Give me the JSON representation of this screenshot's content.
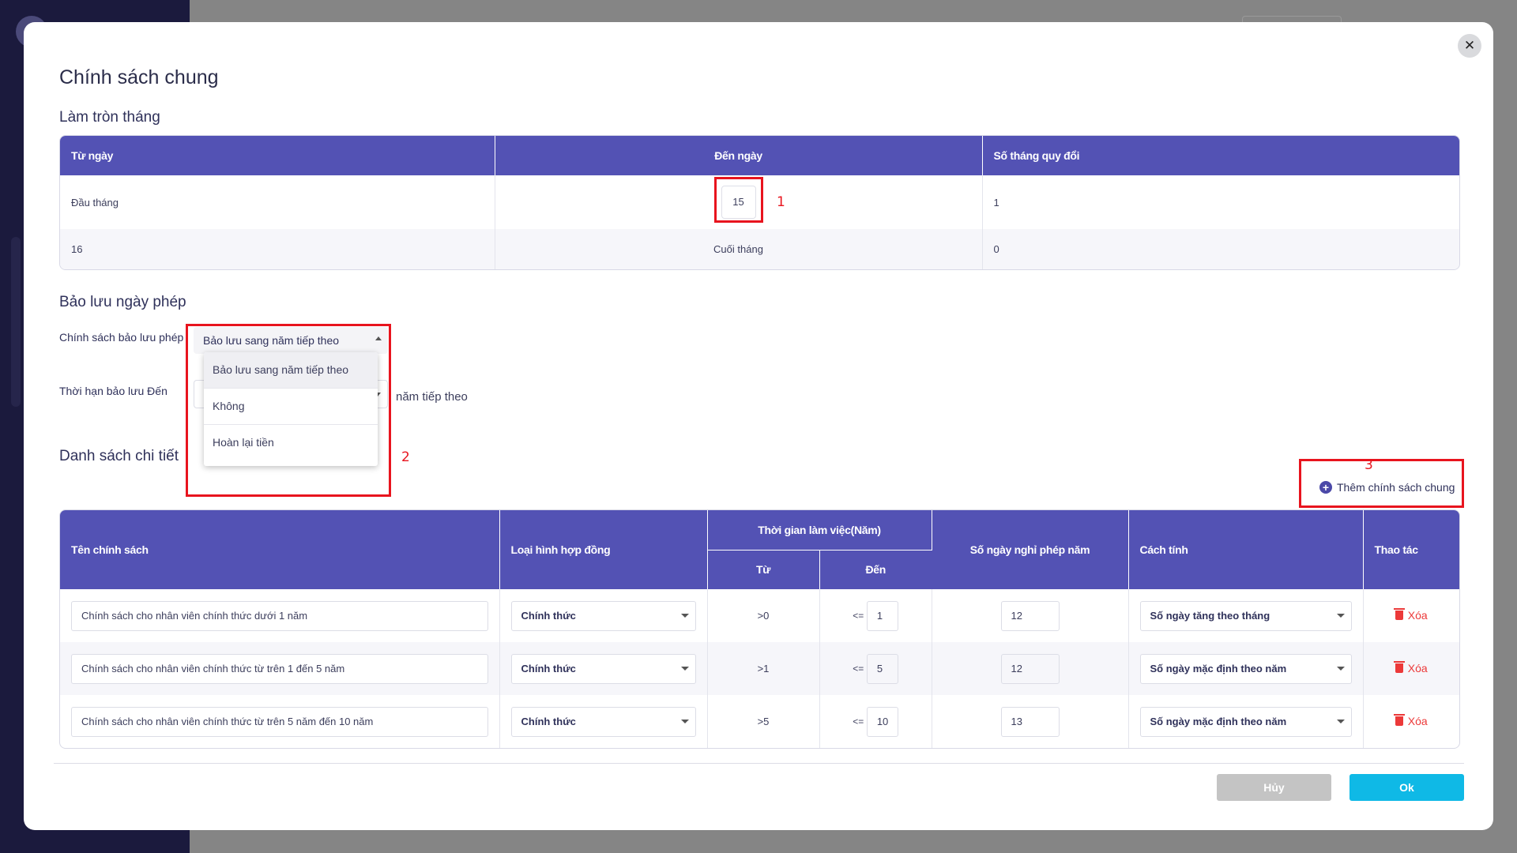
{
  "modal": {
    "title": "Chính sách chung",
    "close_glyph": "✕"
  },
  "rounding": {
    "title": "Làm tròn tháng",
    "headers": [
      "Từ ngày",
      "Đến ngày",
      "Số tháng quy đổi"
    ],
    "rows": [
      {
        "from": "Đầu tháng",
        "to": "15",
        "months": "1"
      },
      {
        "from": "16",
        "to": "Cuối tháng",
        "months": "0"
      }
    ]
  },
  "carryover": {
    "title": "Bảo lưu ngày phép",
    "policy_label": "Chính sách bảo lưu phép",
    "policy_value": "Bảo lưu sang năm tiếp theo",
    "deadline_label": "Thời hạn bảo lưu Đến",
    "deadline_suffix": "năm tiếp theo",
    "options": [
      "Bảo lưu sang năm tiếp theo",
      "Không",
      "Hoàn lại tiền"
    ]
  },
  "details": {
    "title": "Danh sách chi tiết",
    "add_label": "Thêm chính sách chung",
    "headers": {
      "name": "Tên chính sách",
      "contract": "Loại hình hợp đồng",
      "work_time": "Thời gian làm việc(Năm)",
      "from": "Từ",
      "to": "Đến",
      "days": "Số ngày nghỉ phép năm",
      "method": "Cách tính",
      "action": "Thao tác"
    },
    "rows": [
      {
        "name": "Chính sách cho nhân viên chính thức dưới 1 năm",
        "contract": "Chính thức",
        "from": ">0",
        "op": "<=",
        "to": "1",
        "days": "12",
        "method": "Số ngày tăng theo tháng",
        "delete": "Xóa"
      },
      {
        "name": "Chính sách cho nhân viên chính thức từ trên 1 đến 5 năm",
        "contract": "Chính thức",
        "from": ">1",
        "op": "<=",
        "to": "5",
        "days": "12",
        "method": "Số ngày mặc định theo năm",
        "delete": "Xóa"
      },
      {
        "name": "Chính sách cho nhân viên chính thức từ trên 5 năm đến 10 năm",
        "contract": "Chính thức",
        "from": ">5",
        "op": "<=",
        "to": "10",
        "days": "13",
        "method": "Số ngày mặc định theo năm",
        "delete": "Xóa"
      }
    ]
  },
  "annotations": {
    "one": "1",
    "two": "2",
    "three": "3"
  },
  "footer": {
    "cancel": "Hủy",
    "ok": "Ok"
  },
  "colors": {
    "header": "#5352b4",
    "ok": "#0fb9e6",
    "cancel": "#c4c4c4",
    "annotation": "#e8141e",
    "delete": "#ec3939"
  }
}
